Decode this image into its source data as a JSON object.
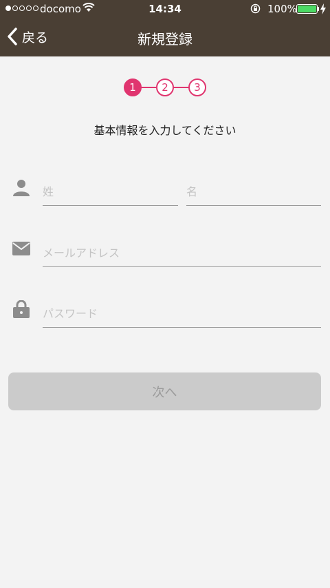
{
  "status_bar": {
    "carrier": "docomo",
    "time": "14:34",
    "battery_percent": "100%",
    "battery_level": 1.0,
    "signal_bars_filled": 1,
    "signal_bars_total": 5
  },
  "nav": {
    "back_label": "戻る",
    "title": "新規登録"
  },
  "steps": {
    "items": [
      "1",
      "2",
      "3"
    ],
    "current": 1
  },
  "instruction": "基本情報を入力してください",
  "form": {
    "last_name_placeholder": "姓",
    "first_name_placeholder": "名",
    "email_placeholder": "メールアドレス",
    "password_placeholder": "パスワード"
  },
  "next_button_label": "次へ",
  "colors": {
    "header_bg": "#4a3f34",
    "accent": "#e0356f",
    "page_bg": "#f3f3f3",
    "button_disabled_bg": "#cbcbcb",
    "battery": "#4cd964"
  },
  "icons": {
    "name_field": "person-icon",
    "email_field": "mail-icon",
    "password_field": "lock-icon",
    "back": "chevron-left-icon"
  }
}
